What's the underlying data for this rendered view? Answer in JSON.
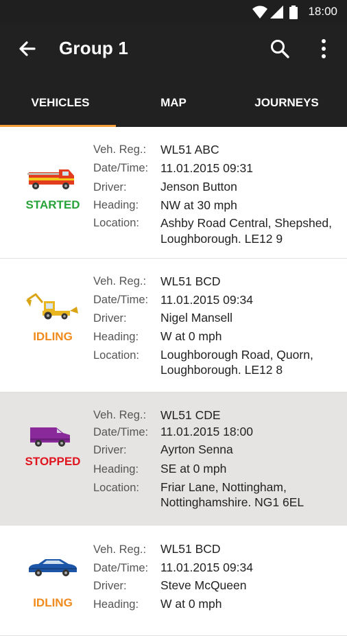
{
  "status_bar": {
    "time": "18:00"
  },
  "app_bar": {
    "title": "Group 1"
  },
  "tabs": [
    {
      "label": "VEHICLES",
      "selected": true
    },
    {
      "label": "MAP",
      "selected": false
    },
    {
      "label": "JOURNEYS",
      "selected": false
    }
  ],
  "field_labels": {
    "reg": "Veh. Reg.:",
    "datetime": "Date/Time:",
    "driver": "Driver:",
    "heading": "Heading:",
    "location": "Location:"
  },
  "vehicles": [
    {
      "icon": "fire-truck-icon",
      "status": "STARTED",
      "status_color": "#27a33a",
      "reg": "WL51 ABC",
      "datetime": "11.01.2015  09:31",
      "driver": "Jenson Button",
      "heading": "NW at 30 mph",
      "location_1": "Ashby Road Central, Shepshed,",
      "location_2": "Loughborough. LE12 9"
    },
    {
      "icon": "digger-icon",
      "status": "IDLING",
      "status_color": "#f08a1c",
      "reg": "WL51 BCD",
      "datetime": "11.01.2015  09:34",
      "driver": "Nigel Mansell",
      "heading": "W at 0 mph",
      "location_1": "Loughborough Road, Quorn,",
      "location_2": "Loughborough. LE12 8"
    },
    {
      "icon": "van-icon",
      "status": "STOPPED",
      "status_color": "#e0141e",
      "reg": "WL51 CDE",
      "datetime": "11.01.2015  18:00",
      "driver": "Ayrton Senna",
      "heading": "SE at 0 mph",
      "location_1": "Friar Lane, Nottingham,",
      "location_2": "Nottinghamshire. NG1 6EL"
    },
    {
      "icon": "car-icon",
      "status": "IDLING",
      "status_color": "#f08a1c",
      "reg": "WL51 BCD",
      "datetime": "11.01.2015  09:34",
      "driver": "Steve McQueen",
      "heading": "W at 0 mph",
      "location_1": "",
      "location_2": ""
    }
  ]
}
